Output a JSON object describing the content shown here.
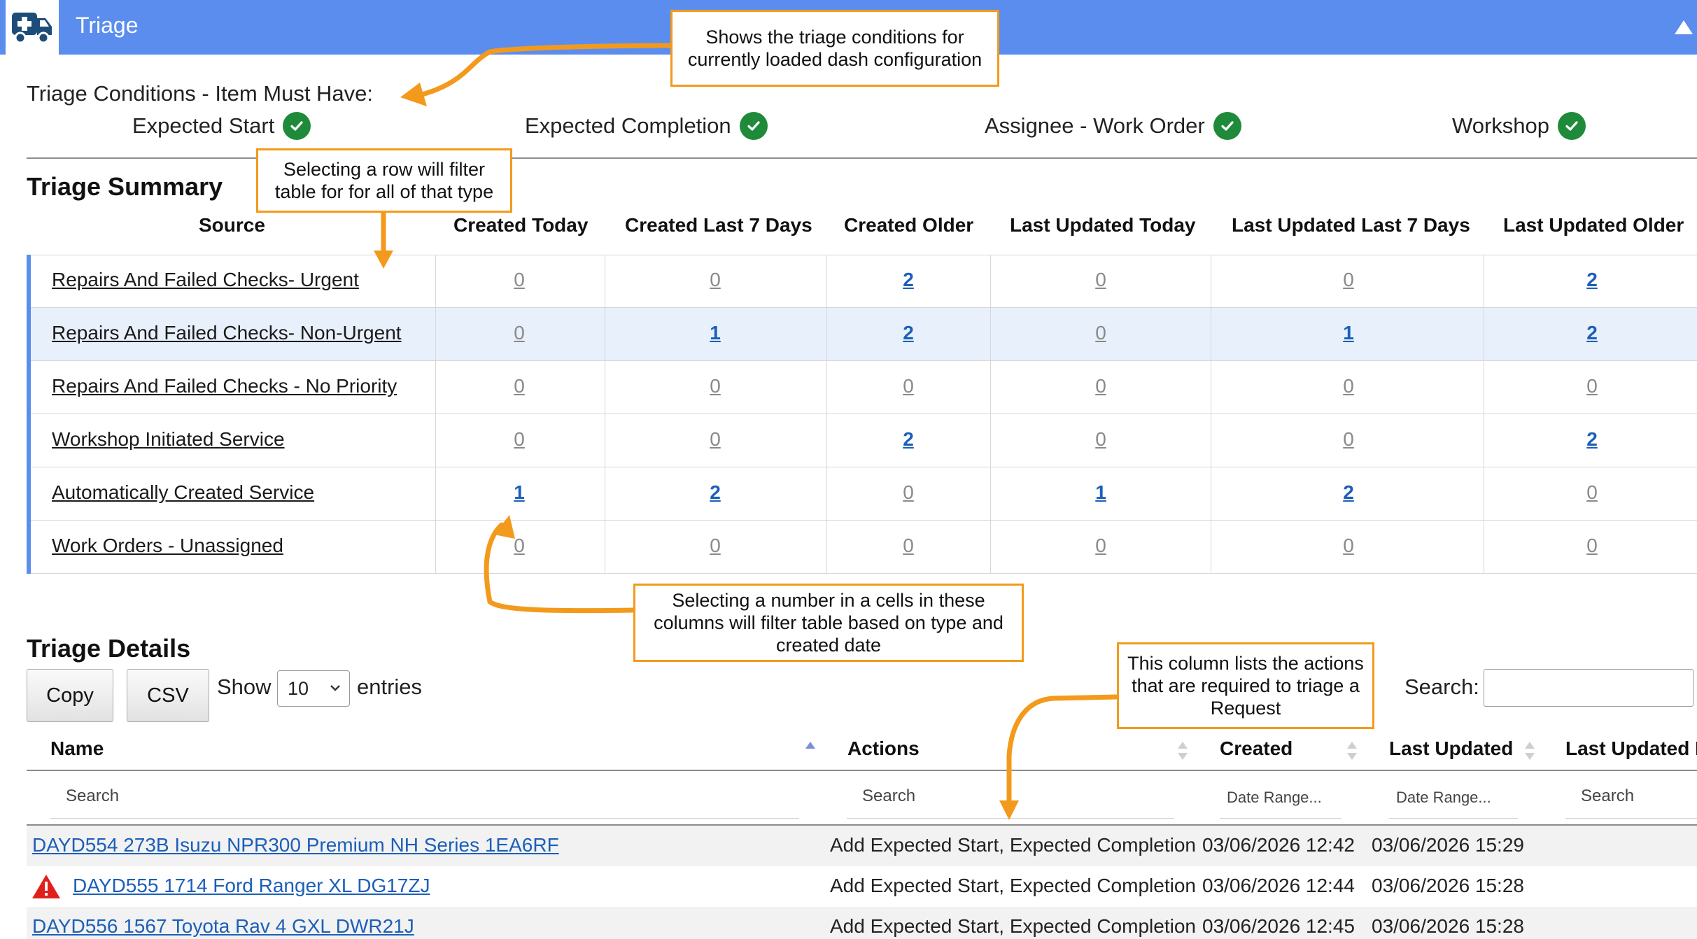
{
  "header": {
    "title": "Triage",
    "logo_icon": "ambulance-icon",
    "collapse_icon": "triangle-up-icon",
    "color": "#5b8def"
  },
  "conditions": {
    "title": "Triage Conditions - Item Must Have:",
    "items": [
      {
        "label": "Expected Start",
        "icon": "check-circle-icon"
      },
      {
        "label": "Expected Completion",
        "icon": "check-circle-icon"
      },
      {
        "label": "Assignee - Work Order",
        "icon": "check-circle-icon"
      },
      {
        "label": "Workshop",
        "icon": "check-circle-icon"
      }
    ]
  },
  "summary": {
    "title": "Triage Summary",
    "columns": [
      "Source",
      "Created Today",
      "Created Last 7 Days",
      "Created Older",
      "Last Updated Today",
      "Last Updated Last 7 Days",
      "Last Updated Older"
    ],
    "rows": [
      {
        "source": "Repairs And Failed Checks- Urgent",
        "values": [
          "0",
          "0",
          "2",
          "0",
          "0",
          "2"
        ]
      },
      {
        "source": "Repairs And Failed Checks- Non-Urgent",
        "values": [
          "0",
          "1",
          "2",
          "0",
          "1",
          "2"
        ]
      },
      {
        "source": "Repairs And Failed Checks - No Priority",
        "values": [
          "0",
          "0",
          "0",
          "0",
          "0",
          "0"
        ]
      },
      {
        "source": "Workshop Initiated Service",
        "values": [
          "0",
          "0",
          "2",
          "0",
          "0",
          "2"
        ]
      },
      {
        "source": "Automatically Created Service",
        "values": [
          "1",
          "2",
          "0",
          "1",
          "2",
          "0"
        ]
      },
      {
        "source": "Work Orders - Unassigned",
        "values": [
          "0",
          "0",
          "0",
          "0",
          "0",
          "0"
        ]
      }
    ]
  },
  "details": {
    "title": "Triage Details",
    "copy_label": "Copy",
    "csv_label": "CSV",
    "show_label": "Show",
    "entries_value": "10",
    "entries_label": "entries",
    "search_label": "Search:",
    "search_value": "",
    "columns": [
      "Name",
      "Actions",
      "Created",
      "Last Updated",
      "Last Updated B"
    ],
    "filters": [
      "Search",
      "Search",
      "Date Range...",
      "Date Range...",
      "Search"
    ],
    "rows": [
      {
        "name": "DAYD554 273B Isuzu NPR300 Premium NH Series 1EA6RF",
        "actions": "Add Expected Start, Expected Completion",
        "created": "03/06/2026 12:42",
        "last_updated": "03/06/2026 15:29",
        "warning": false
      },
      {
        "name": " DAYD555 1714 Ford Ranger XL DG17ZJ",
        "actions": "Add Expected Start, Expected Completion",
        "created": "03/06/2026 12:44",
        "last_updated": "03/06/2026 15:28",
        "warning": true
      },
      {
        "name": "DAYD556 1567 Toyota Rav 4 GXL DWR21J",
        "actions": "Add Expected Start, Expected Completion",
        "created": "03/06/2026 12:45",
        "last_updated": "03/06/2026 15:28",
        "warning": false
      }
    ]
  },
  "annotations": {
    "conditions_note": [
      "Shows the triage conditions for",
      "currently loaded dash configuration"
    ],
    "row_note": [
      "Selecting a row will filter",
      "table for for all of that type"
    ],
    "cell_note": [
      "Selecting a number in a cells in  these",
      "columns will filter table based on type and",
      "created date"
    ],
    "actions_note": [
      "This column lists the actions",
      "that are required to triage a",
      "Request"
    ],
    "color": "#f39a1c"
  },
  "colors": {
    "accent": "#5b8def",
    "link": "#1c5fb8",
    "success": "#1e8a3a",
    "warning": "#e0201b",
    "row_alt": "#e8f0fb"
  }
}
